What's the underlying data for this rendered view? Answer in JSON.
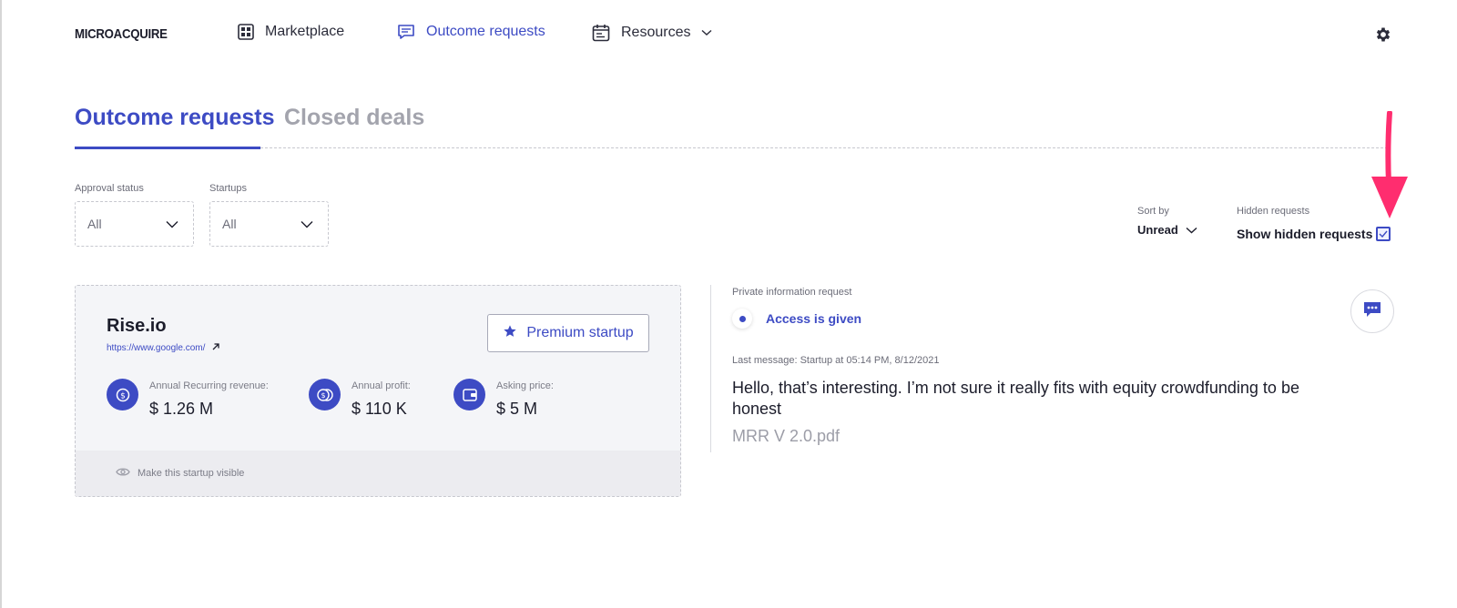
{
  "brand": "MICROACQUIRE",
  "nav": {
    "marketplace": "Marketplace",
    "outcome_requests": "Outcome requests",
    "resources": "Resources"
  },
  "tabs": {
    "outcome": "Outcome requests",
    "closed": "Closed deals"
  },
  "filters": {
    "approval_label": "Approval status",
    "approval_value": "All",
    "startups_label": "Startups",
    "startups_value": "All"
  },
  "sort": {
    "label": "Sort by",
    "value": "Unread"
  },
  "hidden": {
    "label": "Hidden requests",
    "text": "Show hidden requests",
    "checked": true
  },
  "startup": {
    "name": "Rise.io",
    "url": "https://www.google.com/",
    "premium_label": "Premium startup",
    "metrics": [
      {
        "label": "Annual Recurring revenue:",
        "value": "$ 1.26 M",
        "icon": "dollar-coin-icon"
      },
      {
        "label": "Annual profit:",
        "value": "$ 110 K",
        "icon": "coins-icon"
      },
      {
        "label": "Asking price:",
        "value": "$ 5 M",
        "icon": "wallet-icon"
      }
    ],
    "visibility_label": "Make this startup visible"
  },
  "request": {
    "type_label": "Private information request",
    "status": "Access is given",
    "last_message": "Last message: Startup at 05:14 PM, 8/12/2021",
    "message": "Hello, that’s interesting. I’m not sure it really fits with equity crowdfunding to be honest",
    "attachment": "MRR V 2.0.pdf"
  },
  "colors": {
    "accent": "#3d4bc4",
    "annotation_arrow": "#ff2d6f",
    "muted_text": "#6b6c78"
  }
}
